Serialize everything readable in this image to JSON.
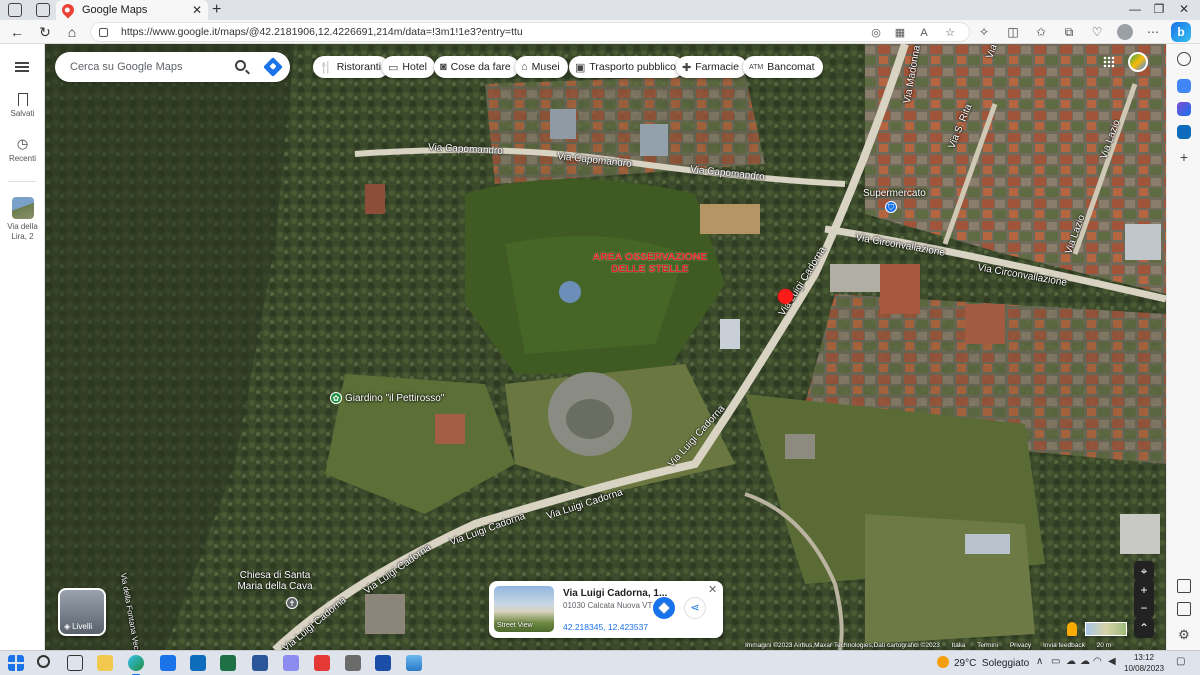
{
  "browser": {
    "tab_title": "Google Maps",
    "url": "https://www.google.it/maps/@42.2181906,12.4226691,214m/data=!3m1!1e3?entry=ttu"
  },
  "rail": {
    "saved_label": "Salvati",
    "recent_label": "Recenti",
    "recent_place_label": "Via della Lira, 2"
  },
  "search": {
    "placeholder": "Cerca su Google Maps"
  },
  "chips": [
    {
      "label": "Ristoranti",
      "icon": "fork-knife-icon"
    },
    {
      "label": "Hotel",
      "icon": "bed-icon"
    },
    {
      "label": "Cose da fare",
      "icon": "camera-icon"
    },
    {
      "label": "Musei",
      "icon": "museum-icon"
    },
    {
      "label": "Trasporto pubblico",
      "icon": "bus-icon"
    },
    {
      "label": "Farmacie",
      "icon": "pharmacy-icon"
    },
    {
      "label": "Bancomat",
      "icon": "atm-icon"
    }
  ],
  "map": {
    "roads": {
      "capomandro_1": "Via Capomandro",
      "capomandro_2": "Via Capomandro",
      "capomandro_3": "Via Capomandro",
      "circonvallazione_1": "Via Circonvallazione",
      "circonvallazione_2": "Via Circonvallazione",
      "cadorna_1": "Via Luigi Cadorna",
      "cadorna_2": "Via Luigi Cadorna",
      "cadorna_3": "Via Luigi Cadorna",
      "cadorna_4": "Via Luigi Cadorna",
      "cadorna_5": "Via Luigi Cadorna",
      "cadorna_6": "Via Luigi Cadorna",
      "s_rita": "Via S. Rita",
      "lazio_1": "Via Lazio",
      "lazio_2": "Via Lazio",
      "madonna": "Via Madonna",
      "via_top": "Via",
      "fontana": "Via della Fontana Vecchia"
    },
    "pois": {
      "supermercato": "Supermercato",
      "giardino": "Giardino \"il Pettirosso\"",
      "chiesa": "Chiesa di Santa Maria della Cava"
    },
    "annotation": "AREA OSSERVAZIONE DELLE STELLE",
    "layers_label": "Livelli"
  },
  "card": {
    "title": "Via Luigi Cadorna, 1...",
    "address": "01030 Calcata Nuova VT",
    "coords": "42.218345, 12.423537",
    "street_view_label": "Street View"
  },
  "attribution": {
    "imagery": "Immagini ©2023 Airbus,Maxar Technologies,Dati cartografici ©2023",
    "country": "Italia",
    "terms": "Termini",
    "privacy": "Privacy",
    "feedback": "Invia feedback",
    "scale": "20 m"
  },
  "taskbar": {
    "temperature": "29°C",
    "weather": "Soleggiato",
    "time": "13:12",
    "date": "10/08/2023"
  }
}
